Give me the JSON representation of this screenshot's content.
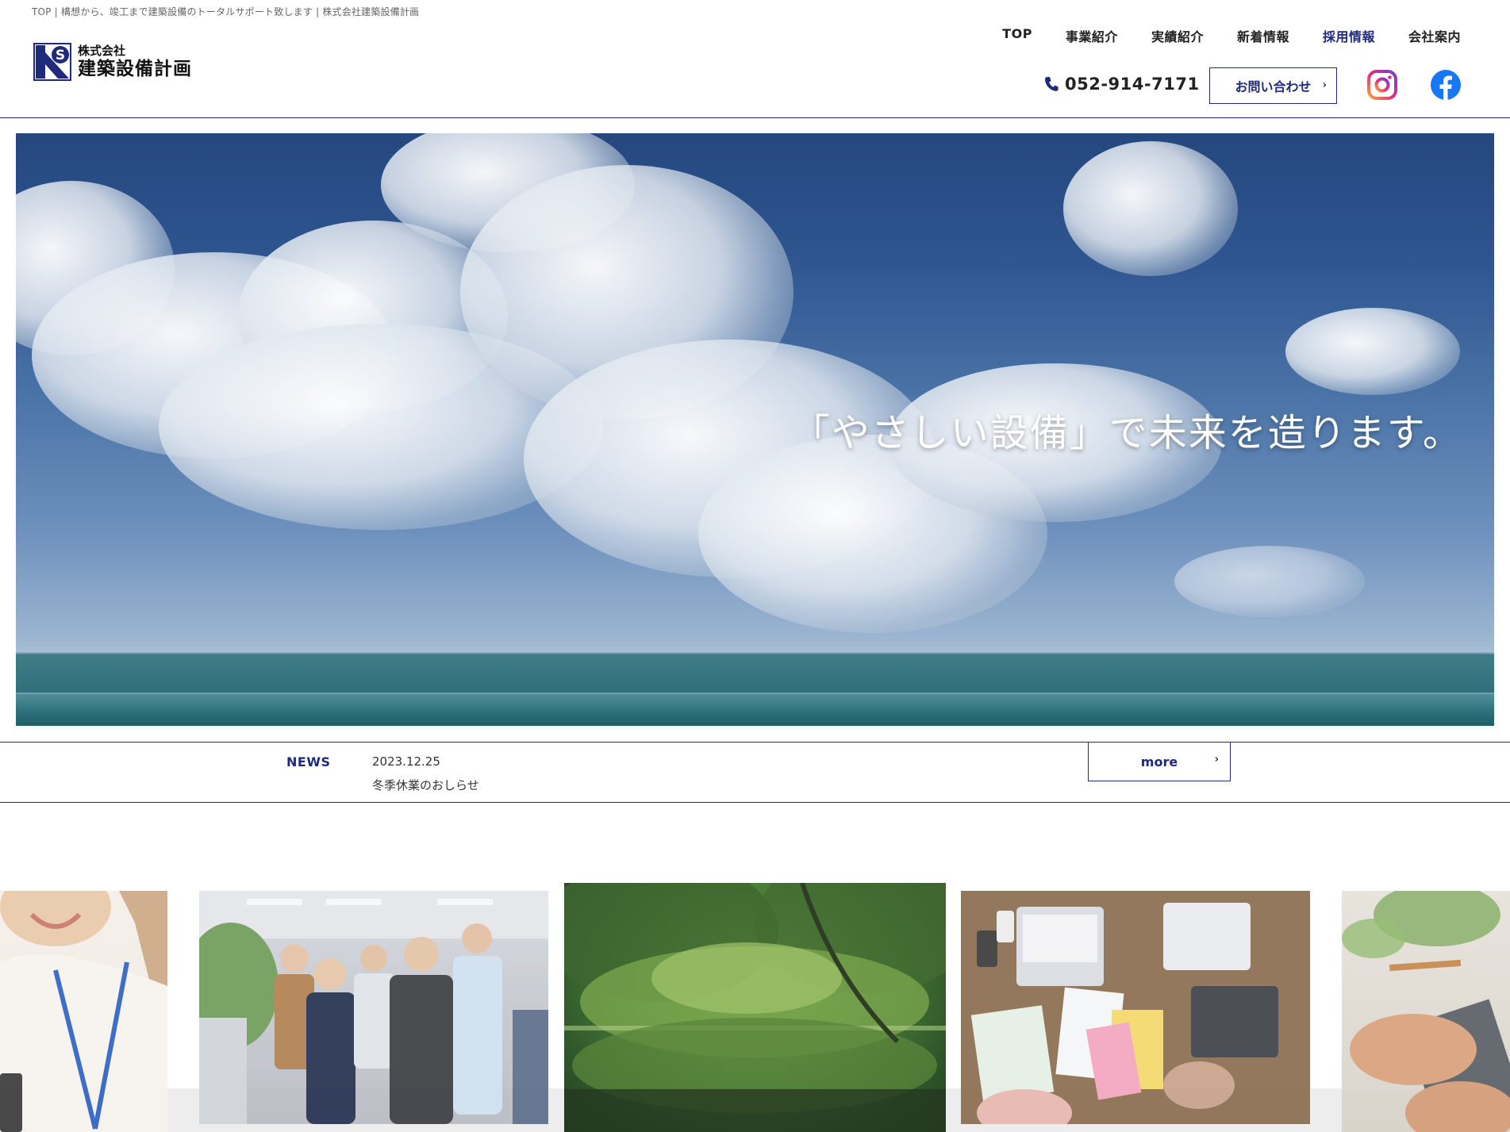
{
  "header": {
    "breadcrumb": "TOP | 構想から、竣工まで建築設備のトータルサポート致します | 株式会社建築設備計画",
    "logo_sub": "株式会社",
    "logo_main": "建築設備計画",
    "nav": [
      {
        "label": "TOP"
      },
      {
        "label": "事業紹介"
      },
      {
        "label": "実績紹介"
      },
      {
        "label": "新着情報"
      },
      {
        "label": "採用情報"
      },
      {
        "label": "会社案内"
      }
    ],
    "tel": "052-914-7171",
    "contact_label": "お問い合わせ",
    "colors": {
      "accent": "#1f2a7a",
      "facebook": "#1877f2"
    }
  },
  "hero": {
    "copy": "「やさしい設備」で未来を造ります。"
  },
  "news": {
    "label": "NEWS",
    "date": "2023.12.25",
    "title": "冬季休業のおしらせ",
    "more_label": "more"
  },
  "icons": {
    "phone": "phone-icon",
    "instagram": "instagram-icon",
    "facebook": "facebook-icon",
    "chevron": "chevron-right-icon"
  }
}
